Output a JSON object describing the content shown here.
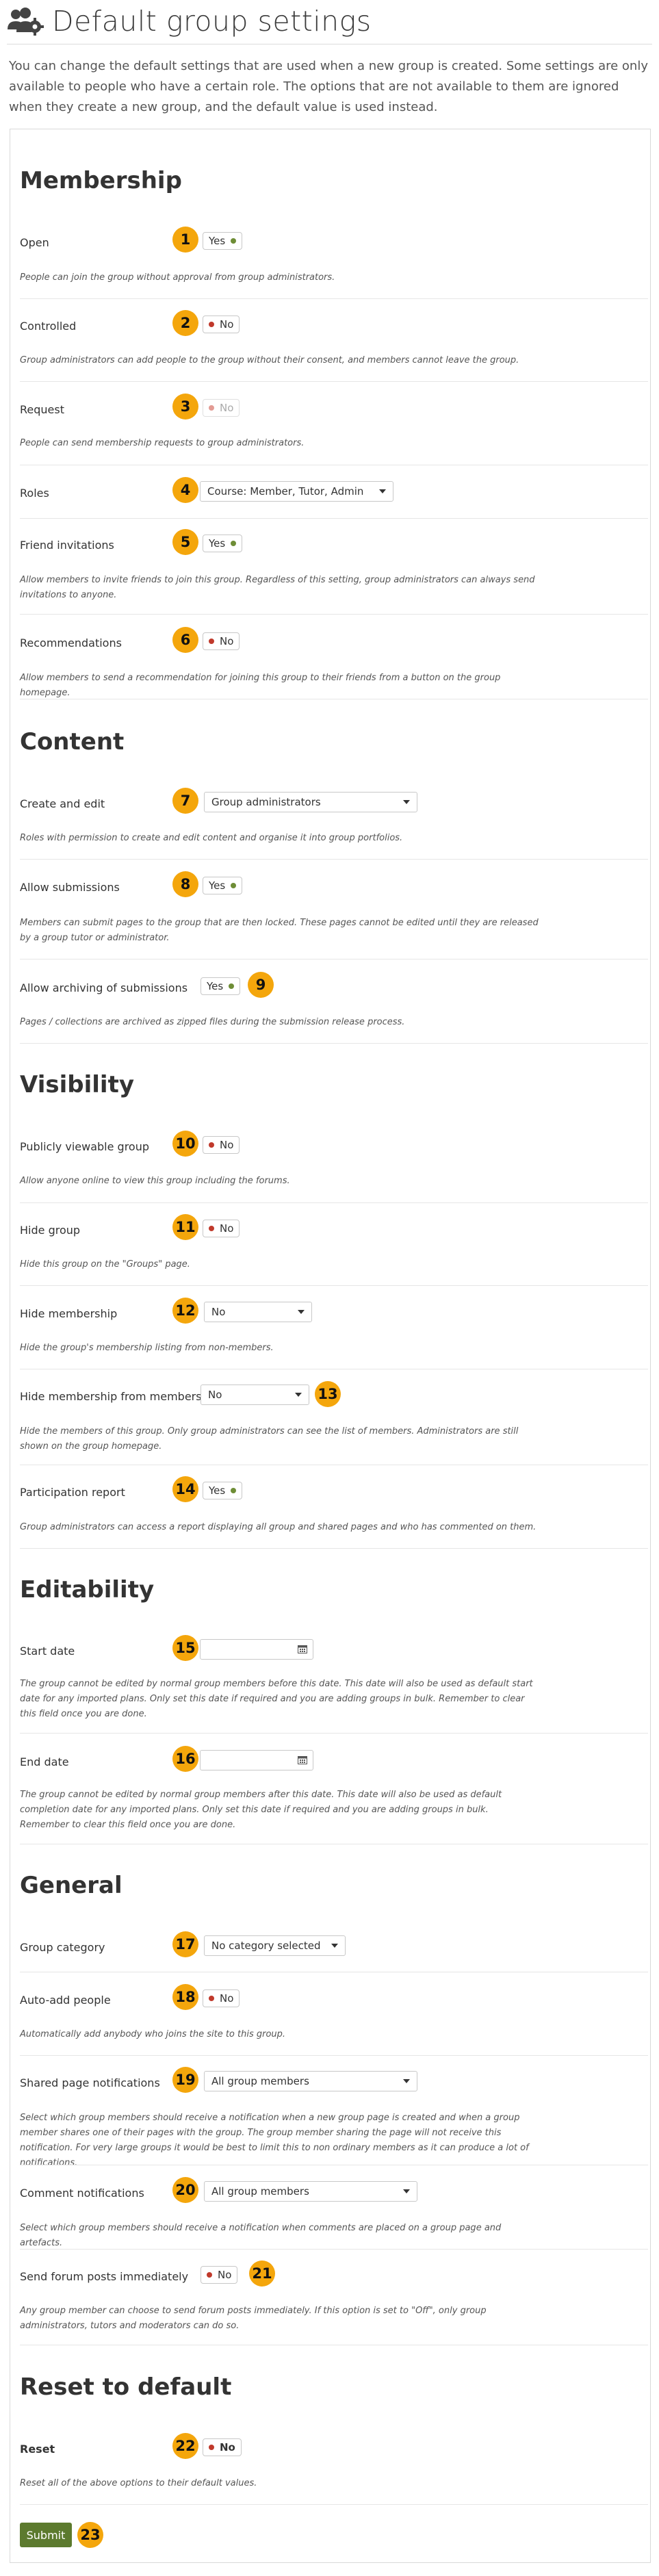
{
  "page": {
    "title": "Default group settings",
    "intro": "You can change the default settings that are used when a new group is created. Some settings are only available to people who have a certain role. The options that are not available to them are ignored when they create a new group, and the default value is used instead."
  },
  "sections": {
    "membership": "Membership",
    "content": "Content",
    "visibility": "Visibility",
    "editability": "Editability",
    "general": "General",
    "reset": "Reset to default"
  },
  "fields": {
    "open": {
      "label": "Open",
      "value": "Yes",
      "badge": "1",
      "desc": "People can join the group without approval from group administrators."
    },
    "controlled": {
      "label": "Controlled",
      "value": "No",
      "badge": "2",
      "desc": "Group administrators can add people to the group without their consent, and members cannot leave the group."
    },
    "request": {
      "label": "Request",
      "value": "No",
      "badge": "3",
      "desc": "People can send membership requests to group administrators."
    },
    "roles": {
      "label": "Roles",
      "value": "Course: Member, Tutor, Admin",
      "badge": "4"
    },
    "friend_invitations": {
      "label": "Friend invitations",
      "value": "Yes",
      "badge": "5",
      "desc": "Allow members to invite friends to join this group. Regardless of this setting, group administrators can always send invitations to anyone."
    },
    "recommendations": {
      "label": "Recommendations",
      "value": "No",
      "badge": "6",
      "desc": "Allow members to send a recommendation for joining this group to their friends from a button on the group homepage."
    },
    "create_edit": {
      "label": "Create and edit",
      "value": "Group administrators",
      "badge": "7",
      "desc": "Roles with permission to create and edit content and organise it into group portfolios."
    },
    "allow_submissions": {
      "label": "Allow submissions",
      "value": "Yes",
      "badge": "8",
      "desc": "Members can submit pages to the group that are then locked. These pages cannot be edited until they are released by a group tutor or administrator."
    },
    "allow_archiving": {
      "label": "Allow archiving of submissions",
      "value": "Yes",
      "badge": "9",
      "desc": "Pages / collections are archived as zipped files during the submission release process."
    },
    "public_group": {
      "label": "Publicly viewable group",
      "value": "No",
      "badge": "10",
      "desc": "Allow anyone online to view this group including the forums."
    },
    "hide_group": {
      "label": "Hide group",
      "value": "No",
      "badge": "11",
      "desc": "Hide this group on the \"Groups\" page."
    },
    "hide_membership": {
      "label": "Hide membership",
      "value": "No",
      "badge": "12",
      "desc": "Hide the group's membership listing from non-members."
    },
    "hide_membership_members": {
      "label": "Hide membership from members",
      "value": "No",
      "badge": "13",
      "desc": "Hide the members of this group. Only group administrators can see the list of members. Administrators are still shown on the group homepage."
    },
    "participation_report": {
      "label": "Participation report",
      "value": "Yes",
      "badge": "14",
      "desc": "Group administrators can access a report displaying all group and shared pages and who has commented on them."
    },
    "start_date": {
      "label": "Start date",
      "value": "",
      "badge": "15",
      "desc": "The group cannot be edited by normal group members before this date. This date will also be used as default start date for any imported plans. Only set this date if required and you are adding groups in bulk. Remember to clear this field once you are done."
    },
    "end_date": {
      "label": "End date",
      "value": "",
      "badge": "16",
      "desc": "The group cannot be edited by normal group members after this date. This date will also be used as default completion date for any imported plans. Only set this date if required and you are adding groups in bulk. Remember to clear this field once you are done."
    },
    "group_category": {
      "label": "Group category",
      "value": "No category selected",
      "badge": "17"
    },
    "auto_add": {
      "label": "Auto-add people",
      "value": "No",
      "badge": "18",
      "desc": "Automatically add anybody who joins the site to this group."
    },
    "shared_page_notif": {
      "label": "Shared page notifications",
      "value": "All group members",
      "badge": "19",
      "desc": "Select which group members should receive a notification when a new group page is created and when a group member shares one of their pages with the group. The group member sharing the page will not receive this notification. For very large groups it would be best to limit this to non ordinary members as it can produce a lot of notifications."
    },
    "comment_notif": {
      "label": "Comment notifications",
      "value": "All group members",
      "badge": "20",
      "desc": "Select which group members should receive a notification when comments are placed on a group page and artefacts."
    },
    "forum_posts": {
      "label": "Send forum posts immediately",
      "value": "No",
      "badge": "21",
      "desc": "Any group member can choose to send forum posts immediately. If this option is set to \"Off\", only group administrators, tutors and moderators can do so."
    },
    "reset": {
      "label": "Reset",
      "value": "No",
      "badge": "22",
      "desc": "Reset all of the above options to their default values."
    }
  },
  "submit": {
    "label": "Submit",
    "badge": "23"
  },
  "colors": {
    "accent": "#f4a60c",
    "submit": "#5c7a2e",
    "yes_dot": "#6e8d36",
    "no_dot": "#c0392b"
  }
}
